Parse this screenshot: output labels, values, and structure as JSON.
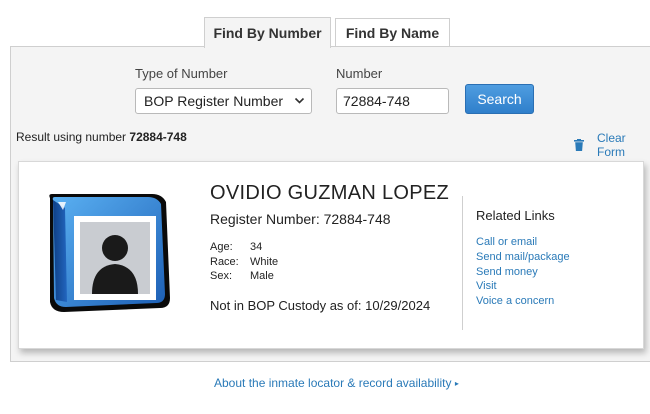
{
  "tabs": {
    "active": "Find By Number",
    "inactive": "Find By Name"
  },
  "form": {
    "type_label": "Type of Number",
    "type_value": "BOP Register Number",
    "number_label": "Number",
    "number_value": "72884-748",
    "search_label": "Search"
  },
  "result": {
    "prefix": "Result using number ",
    "number": "72884-748",
    "clear_label": "Clear Form"
  },
  "inmate": {
    "name": "OVIDIO GUZMAN LOPEZ",
    "register_label": "Register Number: ",
    "register_number": "72884-748",
    "age_label": "Age:",
    "age": "34",
    "race_label": "Race:",
    "race": "White",
    "sex_label": "Sex:",
    "sex": "Male",
    "custody_text": "Not in BOP Custody as of: 10/29/2024"
  },
  "related": {
    "title": "Related Links",
    "links": [
      "Call or email",
      "Send mail/package",
      "Send money",
      "Visit",
      "Voice a concern"
    ]
  },
  "footer": {
    "about": "About the inmate locator & record availability"
  },
  "colors": {
    "accent": "#2f7fcb",
    "link": "#2a7ab8",
    "avatar_frame": "#2a72c9"
  }
}
